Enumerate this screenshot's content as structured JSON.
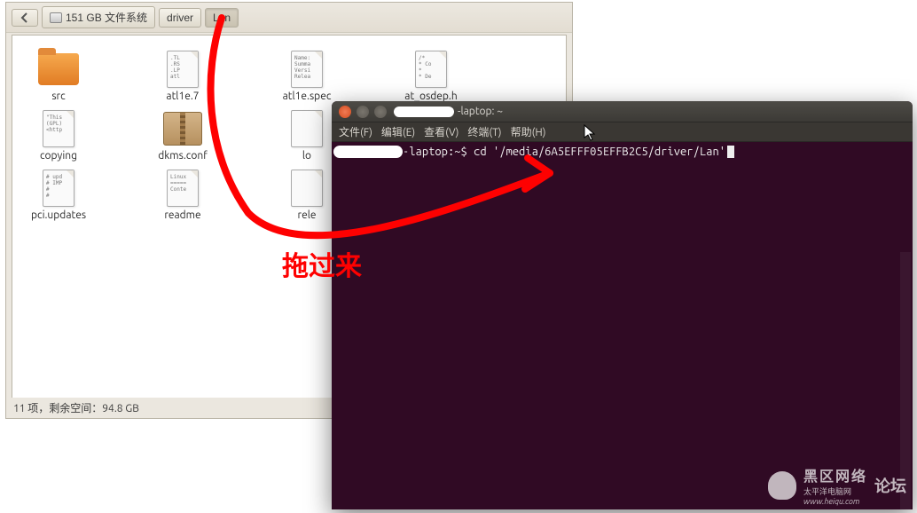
{
  "breadcrumb": {
    "back_label": "",
    "disk_label": "151 GB 文件系统",
    "path1": "driver",
    "path2": "Lan"
  },
  "files": [
    {
      "name": "src",
      "type": "folder",
      "preview": ""
    },
    {
      "name": "atl1e.7",
      "type": "doc",
      "preview": ".TL\n.RS\n.LP\natl"
    },
    {
      "name": "atl1e.spec",
      "type": "doc",
      "preview": "Name:\nSumma\nVersi\nRelea"
    },
    {
      "name": "at_osdep.h",
      "type": "doc",
      "preview": "/* \n* Co\n* \n* De"
    },
    {
      "name": "copying",
      "type": "doc",
      "preview": "\"This\n(GPL)\n<http"
    },
    {
      "name": "dkms.conf",
      "type": "archive",
      "preview": ""
    },
    {
      "name": "lo",
      "type": "doc",
      "preview": ""
    },
    {
      "name": "pci.updates",
      "type": "doc",
      "preview": "# upd\n# IMP\n#\n#"
    },
    {
      "name": "readme",
      "type": "doc",
      "preview": "Linux\n=====\nConte"
    },
    {
      "name": "rele",
      "type": "doc",
      "preview": ""
    }
  ],
  "status_bar": "11 项，剩余空间：94.8 GB",
  "terminal": {
    "title_suffix": "-laptop: ~",
    "menus": [
      "文件(F)",
      "编辑(E)",
      "查看(V)",
      "终端(T)",
      "帮助(H)"
    ],
    "prompt_host_suffix": "-laptop:~$ ",
    "command": "cd '/media/6A5EFFF05EFFB2C5/driver/Lan'"
  },
  "annotation": {
    "text": "拖过来"
  },
  "watermark": {
    "brand_cn": "黑区网络",
    "brand_sub": "太平洋电脑网",
    "brand_url": "www.heiqu.com",
    "brand_bbs": "论坛"
  }
}
